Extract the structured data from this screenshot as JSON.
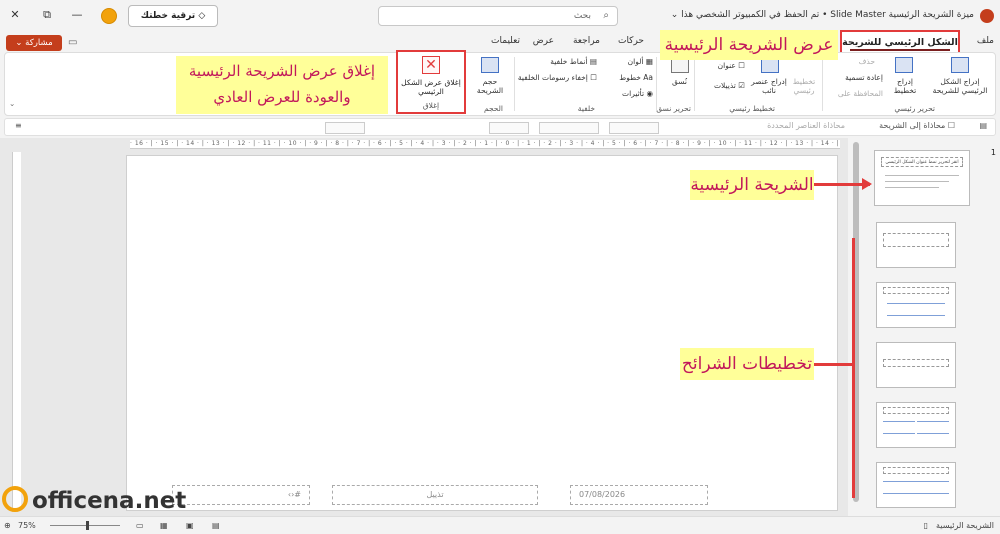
{
  "titlebar": {
    "title": "ميزة الشريحة الرئيسية Slide Master • تم الحفظ في الكمبيوتر الشخصي هذا ⌄",
    "search_placeholder": "بحث",
    "upgrade_label": "ترقية خطتك"
  },
  "tabs": {
    "file": "ملف",
    "active": "الشكل الرئيسي للشريحة",
    "items": [
      "حركات",
      "مراجعة",
      "عرض",
      "تعليمات"
    ],
    "share_label": "مشاركة ⌄"
  },
  "ribbon": {
    "insert_master": "إدراج الشكل الرئيسي للشريحة",
    "insert_layout": "إدراج تخطيط",
    "delete": "حذف",
    "rename": "إعادة تسمية",
    "preserve": "المحافظة على",
    "group_edit_master": "تحرير رئيسي",
    "master_layout": "تخطيط رئيسي",
    "insert_placeholder": "إدراج عنصر نائب",
    "title_cb": "عنوان",
    "footers_cb": "تذييلات",
    "group_master_layout": "تخطيط رئيسي",
    "themes": "نُسق",
    "group_edit_theme": "تحرير نسق",
    "colors": "ألوان",
    "fonts": "خطوط",
    "effects": "تأثيرات",
    "bg_styles": "أنماط خلفية",
    "hide_bg": "إخفاء رسومات الخلفية",
    "group_background": "خلفية",
    "slide_size": "حجم الشريحة",
    "group_size": "الحجم",
    "close_master": "إغلاق عرض الشكل الرئيسي",
    "group_close": "إغلاق"
  },
  "toolbar2": {
    "align_to_slide": "محاذاة إلى الشريحة",
    "align_selected": "محاذاة العناصر المحددة"
  },
  "slide": {
    "date": "07/08/2026",
    "footer": "تذييل",
    "number": "#‹›"
  },
  "thumbs": {
    "number": "1",
    "master_title": "انقر لتحرير نمط عنوان الشكل الرئيسي"
  },
  "status": {
    "view_label": "الشريحة الرئيسية",
    "zoom": "75%"
  },
  "callouts": {
    "slide_master_view": "عرض الشريحة الرئيسية",
    "close_line1": "إغلاق عرض الشريحة الرئيسية",
    "close_line2": "والعودة للعرض العادي",
    "master_slide": "الشريحة الرئيسية",
    "layouts": "تخطيطات الشرائح"
  },
  "logo": {
    "text": "officena.net"
  },
  "colors": {
    "accent": "#c43e1c",
    "callout_bg": "#ffff99",
    "callout_text": "#c2185b",
    "highlight_border": "#e23b3b"
  }
}
